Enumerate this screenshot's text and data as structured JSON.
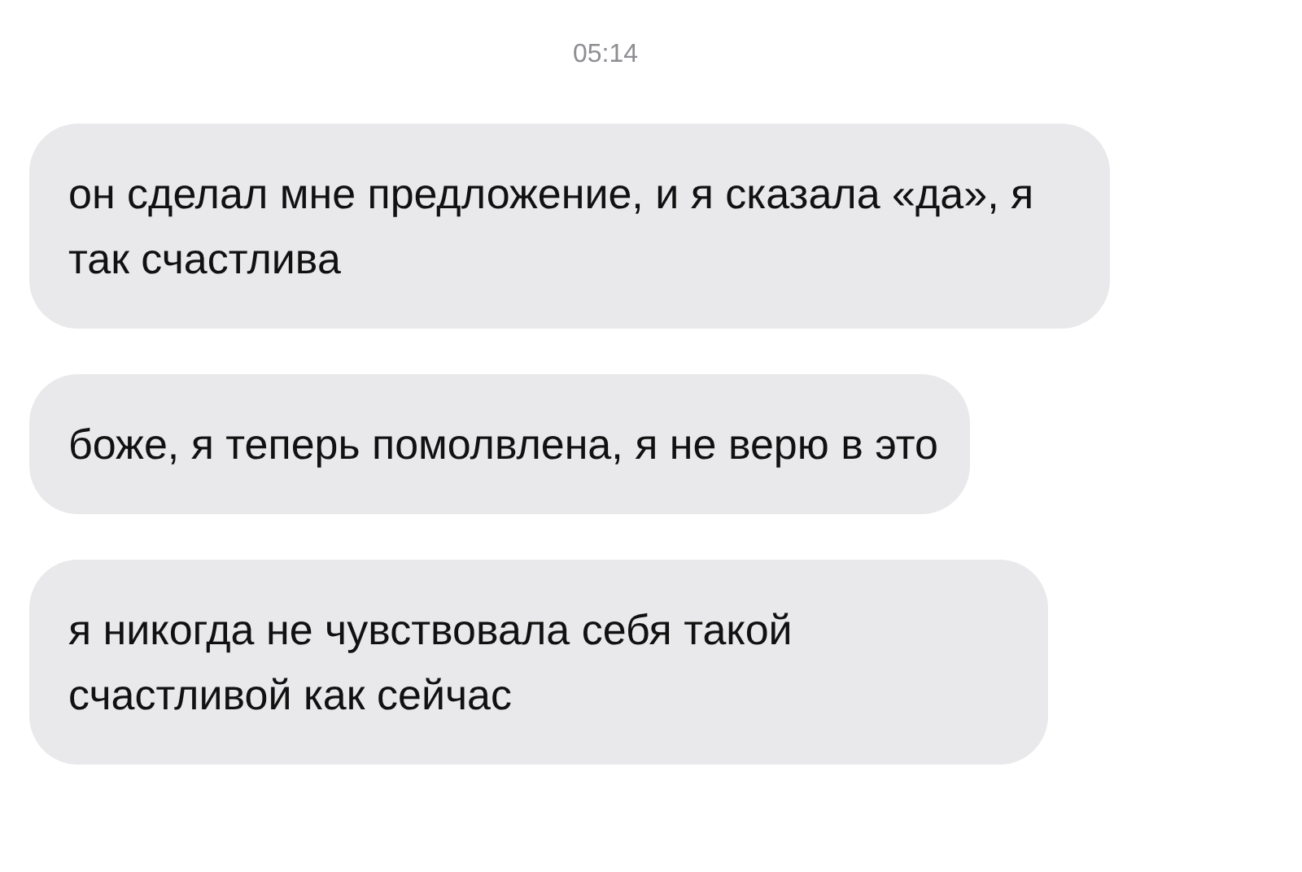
{
  "timestamp": "05:14",
  "messages": [
    {
      "text": "он сделал мне предложение, и я сказала «да», я так счастлива"
    },
    {
      "text": "боже, я теперь помолвлена, я не верю в это"
    },
    {
      "text": "я никогда не чувствовала себя такой счастливой как сейчас"
    }
  ]
}
